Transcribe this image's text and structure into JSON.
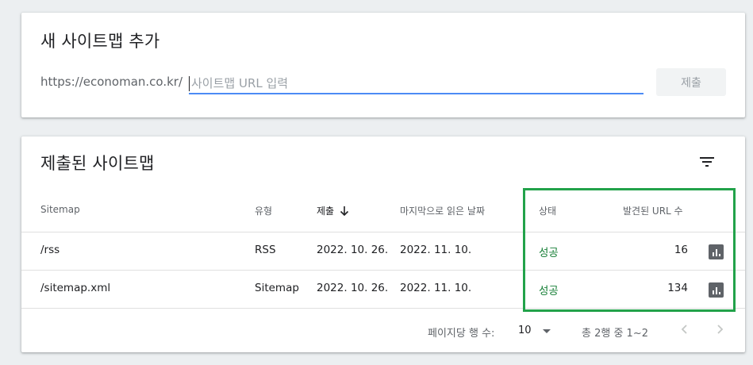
{
  "add_sitemap": {
    "title": "새 사이트맵 추가",
    "url_prefix": "https://economan.co.kr/",
    "input_value": "",
    "input_placeholder": "사이트맵 URL 입력",
    "submit_label": "제출"
  },
  "submitted": {
    "title": "제출된 사이트맵",
    "filter_icon": "filter-list-icon",
    "columns": {
      "sitemap": "Sitemap",
      "type": "유형",
      "submitted": "제출",
      "last_read": "마지막으로 읽은 날짜",
      "status": "상태",
      "url_count": "발견된 URL 수"
    },
    "rows": [
      {
        "sitemap": "/rss",
        "type": "RSS",
        "submitted": "2022. 10. 26.",
        "last_read": "2022. 11. 10.",
        "status": "성공",
        "url_count": "16"
      },
      {
        "sitemap": "/sitemap.xml",
        "type": "Sitemap",
        "submitted": "2022. 10. 26.",
        "last_read": "2022. 11. 10.",
        "status": "성공",
        "url_count": "134"
      }
    ],
    "footer": {
      "rows_per_page_label": "페이지당 행 수:",
      "rows_per_page_value": "10",
      "range_text": "총 2행 중 1~2"
    }
  },
  "colors": {
    "status_success": "#188038",
    "accent_blue": "#4c8bf5",
    "highlight_green": "#22a24a"
  }
}
